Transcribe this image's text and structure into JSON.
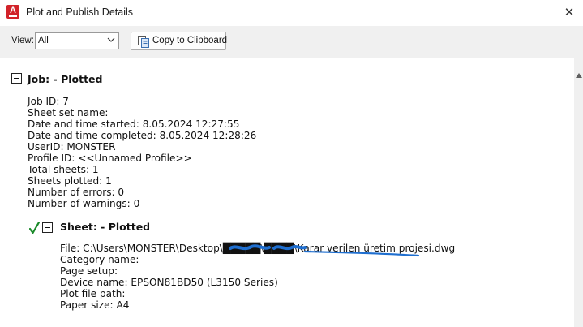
{
  "window": {
    "title": "Plot and Publish Details",
    "close_glyph": "✕"
  },
  "toolbar": {
    "view_label": "View:",
    "view_value": "All",
    "copy_button_label": "Copy to Clipboard"
  },
  "job": {
    "heading": "Job: - Plotted",
    "lines": [
      "Job ID: 7",
      "Sheet set name:",
      "Date and time started: 8.05.2024 12:27:55",
      "Date and time completed: 8.05.2024 12:28:26",
      "UserID: MONSTER",
      "Profile ID: <<Unnamed Profile>>",
      "Total sheets: 1",
      "Sheets plotted: 1",
      "Number of errors: 0",
      "Number of warnings: 0"
    ]
  },
  "sheet": {
    "heading": "Sheet: - Plotted",
    "status_icon": "checkmark-icon",
    "lines": [
      "File: C:\\Users\\MONSTER\\Desktop\\█████\\████\\Karar verilen üretim projesi.dwg",
      "Category name:",
      "Page setup:",
      "Device name: EPSON81BD50 (L3150 Series)",
      "Plot file path:",
      "Paper size: A4"
    ]
  },
  "colors": {
    "checkmark": "#1a8a2a",
    "app_icon": "#d2232a",
    "redaction_scribble": "#1f6fd0"
  }
}
